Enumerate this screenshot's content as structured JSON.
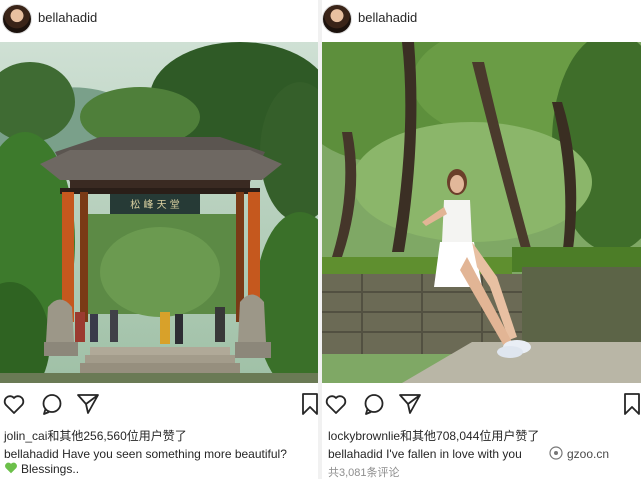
{
  "left_post": {
    "username": "bellahadid",
    "likes_text": "jolin_cai和其他256,560位用户赞了",
    "caption_user": "bellahadid",
    "caption_text": "Have you seen something more beautiful?",
    "caption_line2": "Blessings..",
    "photo_sign": "松 峰 天 堂"
  },
  "right_post": {
    "username": "bellahadid",
    "likes_text": "lockybrownlie和其他708,044位用户赞了",
    "caption_user": "bellahadid",
    "caption_text": "I've fallen in love with you",
    "comments_count": "共3,081条评论"
  },
  "watermark": {
    "text": "gzoo.cn"
  },
  "icons": [
    "heart-icon",
    "comment-icon",
    "share-icon",
    "bookmark-icon",
    "green-heart-emoji"
  ],
  "colors": {
    "text": "#262626",
    "muted": "#8e8e8e",
    "emoji_green": "#6cc04a"
  }
}
